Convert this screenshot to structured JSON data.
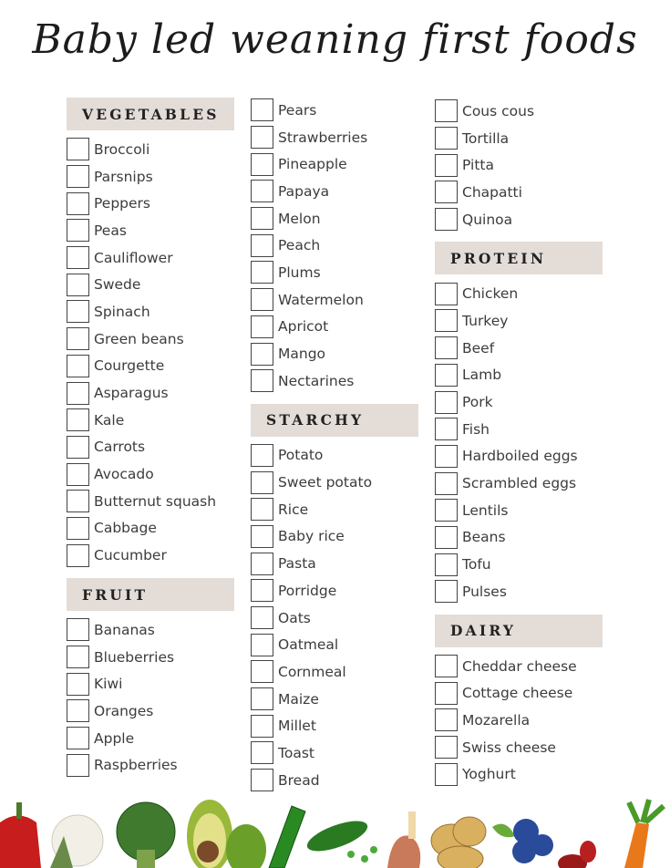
{
  "title": "Baby led weaning first foods",
  "columns": [
    {
      "sections": [
        {
          "header": "VEGETABLES",
          "items": [
            "Broccoli",
            "Parsnips",
            "Peppers",
            "Peas",
            "Cauliflower",
            "Swede",
            "Spinach",
            "Green beans",
            "Courgette",
            "Asparagus",
            "Kale",
            "Carrots",
            "Avocado",
            "Butternut squash",
            "Cabbage",
            "Cucumber"
          ]
        },
        {
          "header": "FRUIT",
          "items": [
            "Bananas",
            "Blueberries",
            "Kiwi",
            "Oranges",
            "Apple",
            "Raspberries"
          ]
        }
      ]
    },
    {
      "sections": [
        {
          "header": null,
          "items": [
            "Pears",
            "Strawberries",
            "Pineapple",
            "Papaya",
            "Melon",
            "Peach",
            "Plums",
            "Watermelon",
            "Apricot",
            "Mango",
            "Nectarines"
          ]
        },
        {
          "header": "STARCHY",
          "items": [
            "Potato",
            "Sweet potato",
            "Rice",
            "Baby rice",
            "Pasta",
            "Porridge",
            "Oats",
            "Oatmeal",
            "Cornmeal",
            "Maize",
            "Millet",
            "Toast",
            "Bread"
          ]
        }
      ]
    },
    {
      "sections": [
        {
          "header": null,
          "items": [
            "Cous cous",
            "Tortilla",
            "Pitta",
            "Chapatti",
            "Quinoa"
          ]
        },
        {
          "header": "PROTEIN",
          "items": [
            "Chicken",
            "Turkey",
            "Beef",
            "Lamb",
            "Pork",
            "Fish",
            "Hardboiled eggs",
            "Scrambled eggs",
            "Lentils",
            "Beans",
            "Tofu",
            "Pulses"
          ]
        },
        {
          "header": "DAIRY",
          "items": [
            "Cheddar cheese",
            "Cottage cheese",
            "Mozarella",
            "Swiss cheese",
            "Yoghurt"
          ]
        }
      ]
    }
  ],
  "footer_illustrations": [
    "red-pepper",
    "cauliflower",
    "broccoli",
    "avocado",
    "cucumber",
    "pea-pod",
    "chicken-drumstick",
    "potatoes",
    "blueberries",
    "kidney-beans",
    "carrot"
  ],
  "colors": {
    "header_bg": "#e4dcd7",
    "text": "#3c3c3c",
    "box_border": "#444444"
  }
}
